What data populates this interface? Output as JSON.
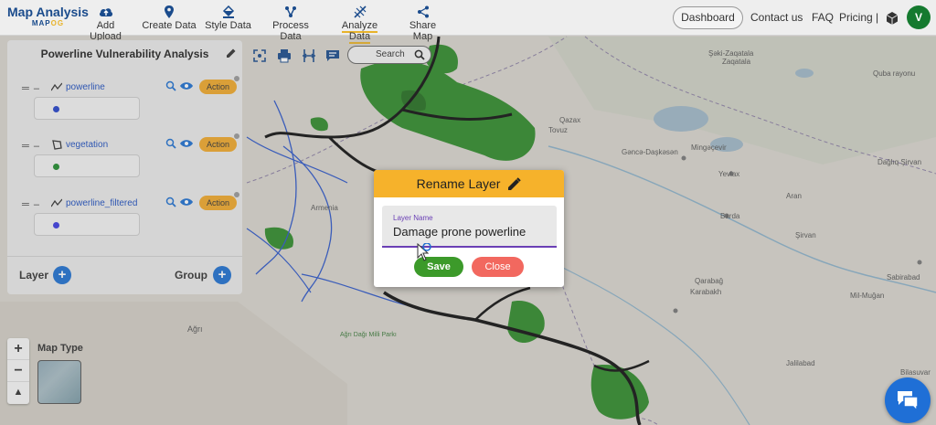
{
  "brand": {
    "title": "Map Analysis",
    "sub_left": "MAP",
    "sub_right": "OG"
  },
  "nav": [
    {
      "label": "Add Upload",
      "icon": "cloud-upload-icon"
    },
    {
      "label": "Create Data",
      "icon": "map-pin-icon"
    },
    {
      "label": "Style Data",
      "icon": "paint-bucket-icon"
    },
    {
      "label": "Process Data",
      "icon": "process-icon"
    },
    {
      "label": "Analyze Data",
      "icon": "analyze-icon",
      "active": true
    },
    {
      "label": "Share Map",
      "icon": "share-icon"
    }
  ],
  "topright": {
    "dashboard": "Dashboard",
    "contact": "Contact us",
    "faq": "FAQ",
    "pricing": "Pricing |",
    "avatar": "V"
  },
  "panel": {
    "title": "Powerline Vulnerability Analysis",
    "layers": [
      {
        "name": "powerline",
        "type": "line",
        "action": "Action",
        "color": "#2442c9"
      },
      {
        "name": "vegetation",
        "type": "polygon",
        "action": "Action",
        "color": "#1f8a2c"
      },
      {
        "name": "powerline_filtered",
        "type": "line",
        "action": "Action",
        "color": "#3a3ae0"
      }
    ],
    "layer_label": "Layer",
    "group_label": "Group"
  },
  "maptools": {
    "search": "Search"
  },
  "map": {
    "zoom_in": "+",
    "zoom_out": "−",
    "north": "▲",
    "map_type_label": "Map Type"
  },
  "dialog": {
    "title": "Rename Layer",
    "field_label": "Layer Name",
    "field_value": "Damage prone powerline",
    "save": "Save",
    "close": "Close"
  },
  "map_labels": [
    "Qazax",
    "Tovuz",
    "Gəncə-Daşkəsən",
    "Mingəçevir",
    "Yevlax",
    "Barda",
    "Şəki-Zaqatala",
    "Quba rayonu",
    "Dağlıq Şirvan",
    "Aran",
    "Zaqatala",
    "Sabirabad",
    "Qarabağ",
    "Karabakh",
    "Mil-Muğan",
    "Bilasuvar",
    "Ağrı",
    "Ağrı Dağı Milli Parkı",
    "Armenia",
    "Jalilabad",
    "Şirvan"
  ],
  "colors": {
    "accent": "#f6b22b",
    "brand": "#1a4b8c",
    "save": "#3c9a2a",
    "close": "#f2685f",
    "underline": "#6a3fb5"
  }
}
